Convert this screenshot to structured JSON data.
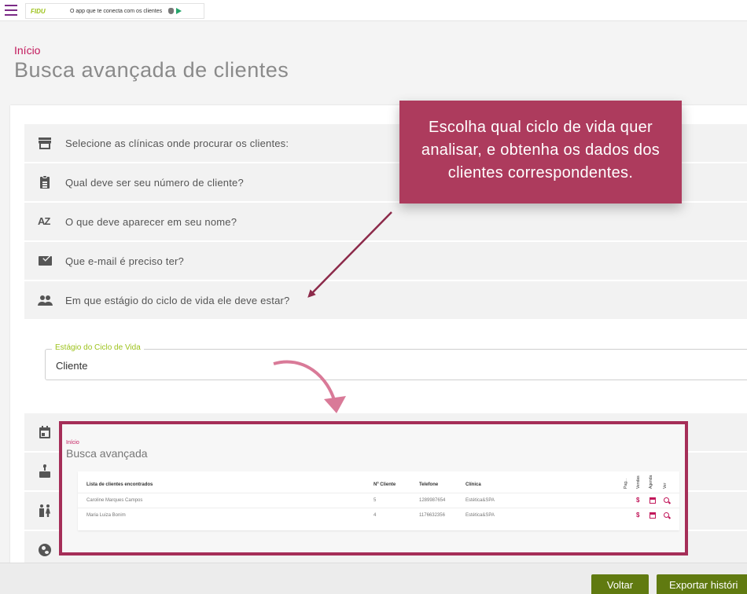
{
  "topbar": {
    "ad_logo": "FIDU",
    "ad_text": "O app que te conecta com os clientes"
  },
  "page": {
    "breadcrumb": "Início",
    "title": "Busca avançada de clientes"
  },
  "filters": [
    {
      "icon": "store-icon",
      "label": "Selecione as clínicas onde procurar os clientes:"
    },
    {
      "icon": "clipboard-icon",
      "label": "Qual deve ser seu número de cliente?"
    },
    {
      "icon": "sort-alpha-icon",
      "label": "O que deve aparecer em seu nome?",
      "icon_glyph": "AZ"
    },
    {
      "icon": "email-icon",
      "label": "Que e-mail é preciso ter?"
    },
    {
      "icon": "people-icon",
      "label": "Em que estágio do ciclo de vida ele deve estar?"
    }
  ],
  "lifecycle_field": {
    "legend": "Estágio do Ciclo de Vida",
    "value": "Cliente"
  },
  "collapsed_filter_icons": [
    "calendar-icon",
    "cake-icon",
    "gender-icon",
    "globe-icon"
  ],
  "callout": {
    "text": "Escolha qual ciclo de vida quer analisar, e obtenha os dados dos clientes correspondentes."
  },
  "inset": {
    "breadcrumb": "Início",
    "title": "Busca avançada",
    "headers": {
      "name": "Lista de clientes encontrados",
      "number": "Nº Cliente",
      "phone": "Telefone",
      "clinic": "Clínica",
      "pay": "Pag...",
      "sales": "Vendas",
      "schedule": "Agenda",
      "view": "Ver"
    },
    "rows": [
      {
        "name": "Caroline Marques Campos",
        "number": "5",
        "phone": "1289987654",
        "clinic": "Estética&SPA"
      },
      {
        "name": "Maria Luiza Bonim",
        "number": "4",
        "phone": "1176632356",
        "clinic": "Estética&SPA"
      }
    ],
    "action_glyph": "$"
  },
  "buttons": {
    "back": "Voltar",
    "export": "Exportar históri"
  },
  "colors": {
    "accent": "#ad3b5d",
    "brand_magenta": "#c2185b",
    "legend_green": "#9cc21b",
    "button_green": "#607a10"
  }
}
